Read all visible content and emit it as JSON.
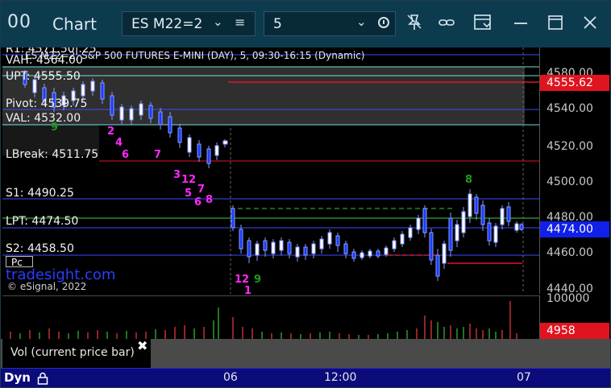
{
  "titlebar": {
    "logo": "00",
    "title": "Chart",
    "symbol": "ES M22=2",
    "interval": "5"
  },
  "chart": {
    "header": "ES M22=2, S&P 500 FUTURES E-MINI (DAY), 5, 09:30-16:15 (Dynamic)",
    "levels": {
      "r1": "R1: 4571.50|.25",
      "vah": "VAH: 4564.00",
      "upt": "UPT: 4555.50",
      "pivot": "Pivot: 4539.75",
      "val": "VAL: 4532.00",
      "lbreak": "LBreak: 4511.75",
      "s1": "S1: 4490.25",
      "lpt": "LPT: 4474.50",
      "s2": "S2: 4458.50",
      "pc": "Pc"
    },
    "site": "tradesight.com",
    "copyright": "© eSignal, 2022"
  },
  "price_axis": {
    "labels": [
      "4580.00",
      "4560.00",
      "4540.00",
      "4520.00",
      "4500.00",
      "4480.00",
      "4460.00",
      "4440.00"
    ],
    "tag_upper": "4555.62",
    "tag_last": "4474.00",
    "tag_upper_color": "#e0141e",
    "tag_last_color": "#1020e8"
  },
  "volume": {
    "axis_label": "100000",
    "current": "4958",
    "current_color": "#e0141e"
  },
  "legend": {
    "text": "Vol (current price bar)",
    "close": "✖"
  },
  "statusbar": {
    "mode": "Dyn",
    "ticks": [
      "06",
      "12:00",
      "07"
    ]
  },
  "seq_numbers": {
    "magenta": [
      "2",
      "4",
      "6",
      "7",
      "3",
      "12",
      "7",
      "5",
      "6",
      "8",
      "12",
      "1"
    ],
    "green": [
      "9",
      "8",
      "9"
    ]
  }
}
